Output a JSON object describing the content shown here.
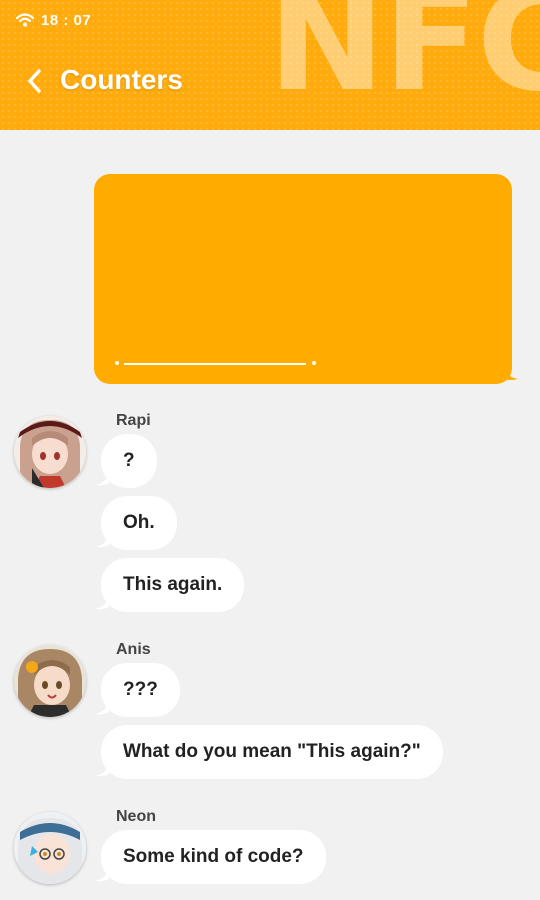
{
  "status": {
    "time": "18 : 07",
    "wifi_icon": "wifi-icon"
  },
  "header": {
    "title": "Counters",
    "back_icon": "chevron-left-icon",
    "watermark": "NFG",
    "color": "#ffab0d"
  },
  "outgoing": {
    "color": "#ffab00"
  },
  "messages": [
    {
      "sender": "Rapi",
      "lines": [
        "?",
        "Oh.",
        "This again."
      ]
    },
    {
      "sender": "Anis",
      "lines": [
        "???",
        "What do you mean \"This again?\""
      ]
    },
    {
      "sender": "Neon",
      "lines": [
        "Some kind of code?"
      ]
    }
  ]
}
